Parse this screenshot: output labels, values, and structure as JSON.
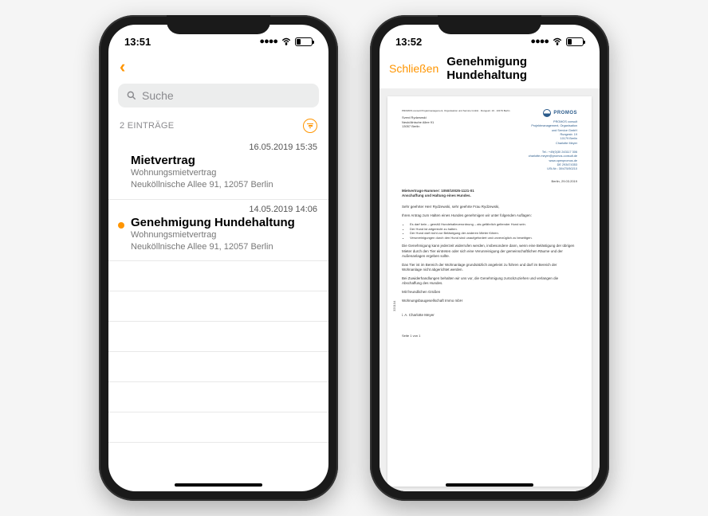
{
  "accent": "#ff9500",
  "phone1": {
    "time": "13:51",
    "search_placeholder": "Suche",
    "list_count_label": "2 EINTRÄGE",
    "entries": [
      {
        "datetime": "16.05.2019 15:35",
        "title": "Mietvertrag",
        "type_label": "Wohnungsmietvertrag",
        "address": "Neuköllnische Allee 91, 12057 Berlin",
        "unread": false
      },
      {
        "datetime": "14.05.2019 14:06",
        "title": "Genehmigung Hundehaltung",
        "type_label": "Wohnungsmietvertrag",
        "address": "Neuköllnische Allee 91, 12057 Berlin",
        "unread": true
      }
    ]
  },
  "phone2": {
    "time": "13:52",
    "close_label": "Schließen",
    "title": "Genehmigung Hundehaltung",
    "doc": {
      "company_logo_text": "PROMOS",
      "company_info": "PROMOS consult\nProjektmanagement, Organisation\nund Service GmbH\nRungestr. 19\n10179 Berlin\nCharlotte Meyer",
      "sender_line": "PROMOS consult Projektmanagement, Organisation und Service GmbH · Rungestr. 19 · 10179 Berlin",
      "recipient": "Sverd Rydzewski\nNeuköllnische Allee 91\n13057 Berlin",
      "contact": "Tel.:  +49(0)30 243117 306\ncharlotte.meyer@promos-consult.de\nwww.openpromos.de\nDE 293474353\nUSt-Nr.: 30/475/50210",
      "date_place": "Berlin, 29.03.2019",
      "subject_line1": "Mietvertrags-Nummer: 1050/10025-1121-01",
      "subject_line2": "Anschaffung und Haltung eines Hundes.",
      "salutation": "Sehr geehrter Herr Rydzewski, sehr geehrte Frau Rydzewski,",
      "intro": "Ihren Antrag zum Halten eines Hundes genehmigen wir unter folgenden Auflagen:",
      "bullets": [
        "Es darf kein – gemäß Hundehalteverordnung – als gefährlich geltender Hund sein.",
        "Der Hund ist artgerecht zu halten.",
        "Der Hund darf nicht zur Belästigung der anderen Mieter führen.",
        "Verunreinigungen durch den Hund sind unaufgefordert und unverzüglich zu beseitigen."
      ],
      "para1": "Die Genehmigung kann jederzeit widerrufen werden, insbesondere dann, wenn eine Belästigung der übrigen Mieter durch den Tier eintreten oder sich eine Verunreinigung der gemeinschaftlichen Räume und der Außenanlagen ergeben sollte.",
      "para2": "Das Tier ist im Bereich der Wohnanlage grundsätzlich angeleint zu führen und darf im Bereich der Wohnanlage nicht abgerichtet werden.",
      "para3": "Bei Zuwiderhandlungen behalten wir uns vor, die Genehmigung zurückzuziehen und verlangen die Abschaffung des Hundes.",
      "closing": "Mit freundlichen Grüßen",
      "signer_org": "Wohnungsbaugesellschaft Immo mbH",
      "signer_name": "i. A. Charlotte Meyer",
      "page_label": "Seite 1 von 1",
      "margin_number": "320104"
    }
  }
}
